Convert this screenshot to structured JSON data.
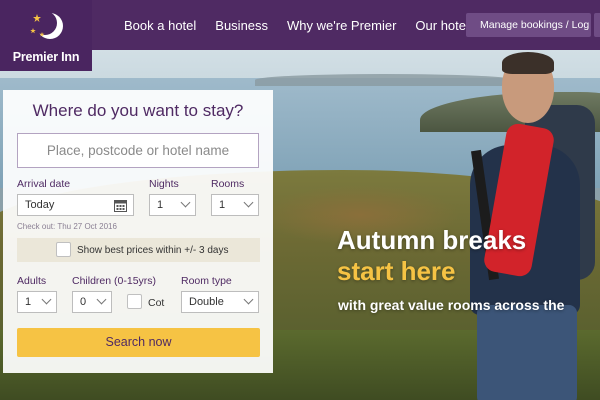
{
  "brand": {
    "name": "Premier Inn",
    "purple": "#4f2a63",
    "yellow": "#f6c344",
    "logo_icon": "moon-stars-icon"
  },
  "nav": {
    "items": [
      {
        "label": "Book a hotel"
      },
      {
        "label": "Business"
      },
      {
        "label": "Why we're Premier"
      },
      {
        "label": "Our hotels"
      }
    ],
    "manage_label": "Manage bookings / Log in",
    "manage_icon": "user-icon"
  },
  "search": {
    "title": "Where do you want to stay?",
    "place_placeholder": "Place, postcode or hotel name",
    "arrival_label": "Arrival date",
    "arrival_value": "Today",
    "calendar_icon": "calendar-icon",
    "nights_label": "Nights",
    "nights_value": "1",
    "rooms_label": "Rooms",
    "rooms_value": "1",
    "checkout_text": "Check out: Thu 27 Oct 2016",
    "best_prices_label": "Show best prices within +/- 3 days",
    "adults_label": "Adults",
    "adults_value": "1",
    "children_label": "Children (0-15yrs)",
    "children_value": "0",
    "cot_label": "Cot",
    "room_type_label": "Room type",
    "room_type_value": "Double",
    "search_button": "Search now"
  },
  "hero": {
    "line1": "Autumn breaks",
    "line2": "start here",
    "line3": "with great value rooms across the"
  }
}
